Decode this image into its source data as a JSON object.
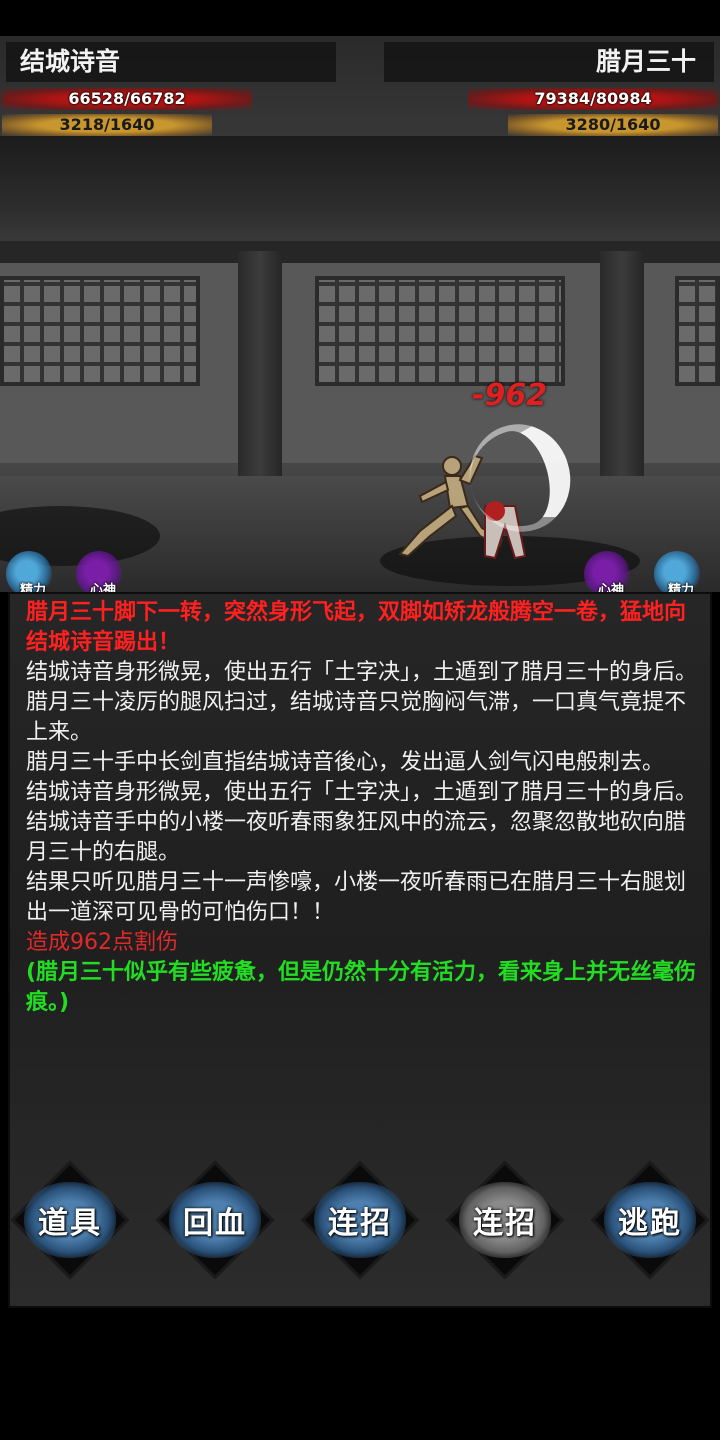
{
  "player": {
    "name": "结城诗音",
    "hp": "66528/66782",
    "mp": "3218/1640",
    "status": {
      "stamina_label": "精力",
      "mind_label": "心神"
    }
  },
  "enemy": {
    "name": "腊月三十",
    "hp": "79384/80984",
    "mp": "3280/1640",
    "status": {
      "stamina_label": "精力",
      "mind_label": "心神"
    }
  },
  "damage_popup": "-962",
  "log": [
    {
      "text": "腊月三十脚下一转，突然身形飞起，双脚如矫龙般腾空一卷，猛地向结城诗音踢出！",
      "color": "red"
    },
    {
      "text": "结城诗音身形微晃，使出五行「土字决」，土遁到了腊月三十的身后。",
      "color": "white"
    },
    {
      "text": "腊月三十凌厉的腿风扫过，结城诗音只觉胸闷气滞，一口真气竟提不上来。",
      "color": "white"
    },
    {
      "text": "腊月三十手中长剑直指结城诗音後心，发出逼人剑气闪电般刺去。",
      "color": "white"
    },
    {
      "text": "结城诗音身形微晃，使出五行「土字决」，土遁到了腊月三十的身后。",
      "color": "white"
    },
    {
      "text": "结城诗音手中的小楼一夜听春雨象狂风中的流云，忽聚忽散地砍向腊月三十的右腿。",
      "color": "white"
    },
    {
      "text": "结果只听见腊月三十一声惨嚎，小楼一夜听春雨已在腊月三十右腿划出一道深可见骨的可怕伤口！！",
      "color": "white"
    },
    {
      "text": "造成962点割伤",
      "color": "dmg"
    },
    {
      "text": "(腊月三十似乎有些疲惫，但是仍然十分有活力，看来身上并无丝毫伤痕。)",
      "color": "green"
    }
  ],
  "actions": {
    "items": "道具",
    "heal": "回血",
    "combo1": "连招",
    "combo2": "连招",
    "flee": "逃跑"
  }
}
